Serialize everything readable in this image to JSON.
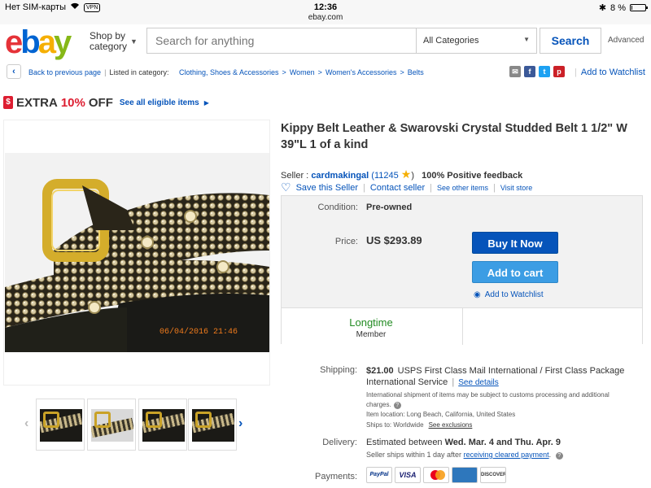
{
  "status_bar": {
    "carrier": "Нет SIM-карты",
    "vpn": "VPN",
    "time": "12:36",
    "url": "ebay.com",
    "battery": "8 %",
    "battery_level": 0.08
  },
  "header": {
    "logo": {
      "e": "e",
      "b": "b",
      "a": "a",
      "y": "y"
    },
    "shop_by": "Shop by",
    "category": "category",
    "search_placeholder": "Search for anything",
    "category_select": "All Categories",
    "search_button": "Search",
    "advanced": "Advanced"
  },
  "breadcrumb": {
    "back": "Back to previous page",
    "listed_in": "Listed in category:",
    "items": [
      "Clothing, Shoes & Accessories",
      "Women",
      "Women's Accessories",
      "Belts"
    ],
    "add_to_watchlist": "Add to Watchlist",
    "share_icons": [
      "mail-icon",
      "facebook-icon",
      "twitter-icon",
      "pinterest-icon"
    ]
  },
  "promo": {
    "tag": "$",
    "extra": "EXTRA",
    "percent": "10%",
    "off": "OFF",
    "link": "See all eligible items"
  },
  "gallery": {
    "photo_timestamp": "06/04/2016 21:46",
    "thumbnail_count": 4
  },
  "item": {
    "title": "Kippy Belt Leather & Swarovski Crystal Studded Belt 1 1/2\" W 39\"L 1 of a kind",
    "seller_label": "Seller :",
    "seller_name": "cardmakingal",
    "feedback_score": "(11245",
    "feedback_close": ")",
    "positive_feedback": "100% Positive feedback",
    "save_seller": "Save this Seller",
    "contact_seller": "Contact seller",
    "see_other_items": "See other items",
    "visit_store": "Visit store"
  },
  "buybox": {
    "condition_label": "Condition:",
    "condition_value": "Pre-owned",
    "price_label": "Price:",
    "price_value": "US $293.89",
    "buy_it_now": "Buy It Now",
    "add_to_cart": "Add to cart",
    "add_to_watchlist": "Add to Watchlist",
    "member_status": "Longtime",
    "member_label": "Member"
  },
  "shipping": {
    "label": "Shipping:",
    "cost": "$21.00",
    "method": "USPS First Class Mail International / First Class Package International Service",
    "see_details": "See details",
    "customs_note": "International shipment of items may be subject to customs processing and additional charges.",
    "item_location": "Item location:  Long Beach, California, United States",
    "ships_to": "Ships to:  Worldwide",
    "see_exclusions": "See exclusions"
  },
  "delivery": {
    "label": "Delivery:",
    "estimated_prefix": "Estimated between",
    "dates": "Wed. Mar. 4 and Thu. Apr. 9",
    "handling_prefix": "Seller ships within 1 day after",
    "handling_link": "receiving cleared payment",
    "handling_suffix": "."
  },
  "payments": {
    "label": "Payments:",
    "methods": [
      "PayPal",
      "VISA",
      "MasterCard",
      "AMERICAN EXPRESS",
      "DISCOVER"
    ]
  },
  "colors": {
    "link": "#0654ba",
    "buy_button": "#0654ba",
    "cart_button": "#3c9de4",
    "promo_red": "#dd1e31",
    "member_green": "#228b22"
  }
}
